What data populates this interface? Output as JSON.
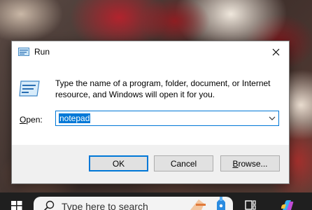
{
  "dialog": {
    "title": "Run",
    "description": "Type the name of a program, folder, document, or Internet resource, and Windows will open it for you.",
    "open_label_accel": "O",
    "open_label_rest": "pen:",
    "input_value": "notepad",
    "buttons": {
      "ok": "OK",
      "cancel": "Cancel",
      "browse_accel": "B",
      "browse_rest": "rowse..."
    }
  },
  "taskbar": {
    "search_placeholder": "Type here to search"
  },
  "colors": {
    "accent": "#0078d7",
    "dialog_bg": "#f0f0f0",
    "taskbar_bg": "#1f1f1f"
  },
  "icons": [
    "run-icon",
    "close-icon",
    "chevron-down-icon",
    "windows-start-icon",
    "search-icon",
    "task-view-icon",
    "copilot-icon"
  ]
}
